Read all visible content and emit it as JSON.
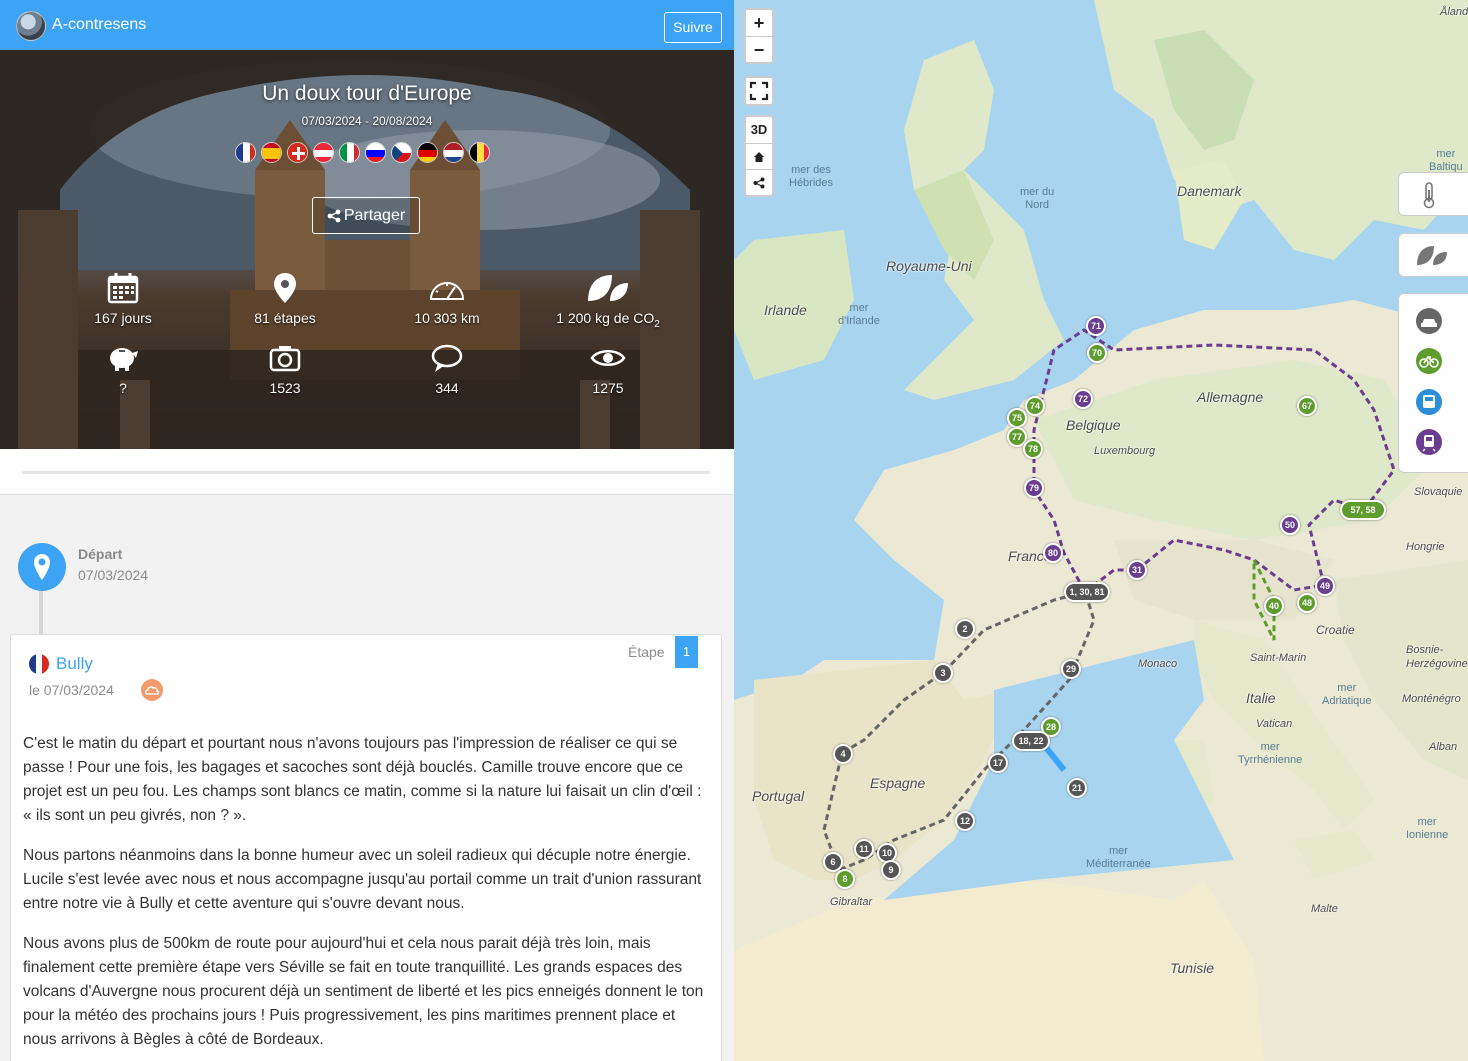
{
  "header": {
    "author": "A-contresens",
    "follow_label": "Suivre"
  },
  "trip": {
    "title": "Un doux tour d'Europe",
    "dates": "07/03/2024 - 20/08/2024",
    "share_label": "Partager",
    "country_flags": [
      "france",
      "spain",
      "switzerland",
      "austria",
      "italy",
      "slovenia",
      "czech-republic",
      "germany",
      "netherlands",
      "belgium"
    ],
    "stats": {
      "days": "167 jours",
      "steps": "81 étapes",
      "distance": "10 303 km",
      "co2": "1 200 kg de CO",
      "co2_sub": "2",
      "budget": "?",
      "photos": "1523",
      "comments": "344",
      "views": "1275"
    }
  },
  "timeline": {
    "start_label": "Départ",
    "start_date": "07/03/2024"
  },
  "step": {
    "place": "Bully",
    "date": "le 07/03/2024",
    "label": "Étape",
    "number": "1",
    "paragraphs": [
      "C'est le matin du départ et pourtant nous n'avons toujours pas l'impression de réaliser ce qui se passe ! Pour une fois, les bagages et sacoches sont déjà bouclés. Camille trouve encore que ce projet est un peu fou. Les champs sont blancs ce matin, comme si la nature lui faisait un clin d'œil : « ils sont un peu givrés, non ? ».",
      "Nous partons néanmoins dans la bonne humeur avec un soleil radieux qui décuple notre énergie. Lucile s'est levée avec nous et nous accompagne jusqu'au portail comme un trait d'union rassurant entre notre vie à Bully et cette aventure qui s'ouvre devant nous.",
      "Nous avons plus de 500km de route pour aujourd'hui et cela nous parait déjà très loin, mais finalement cette première étape vers Séville se fait en toute tranquillité. Les grands espaces des volcans d'Auvergne nous procurent déjà un sentiment de liberté et les pics enneigés donnent le ton pour la météo des prochains jours ! Puis progressivement, les pins maritimes prennent place et nous arrivons à Bègles à côté de Bordeaux."
    ]
  },
  "map": {
    "controls": {
      "zoom_in": "+",
      "zoom_out": "−",
      "three_d": "3D"
    },
    "labels": {
      "danemark": "Danemark",
      "royaume_uni": "Royaume-Uni",
      "irlande": "Irlande",
      "belgique": "Belgique",
      "luxembourg": "Luxembourg",
      "allemagne": "Allemagne",
      "france": "France",
      "espagne": "Espagne",
      "portugal": "Portugal",
      "italie": "Italie",
      "monaco": "Monaco",
      "saint_marin": "Saint-Marin",
      "vatican": "Vatican",
      "croatie": "Croatie",
      "bosnie": "Bosnie-\nHerzégovine",
      "hongrie": "Hongrie",
      "slovaquie": "Slovaquie",
      "montenegro": "Monténégro",
      "albanie": "Alban",
      "tunisie": "Tunisie",
      "malte": "Malte",
      "gibraltar": "Gibraltar",
      "aland": "Åland"
    },
    "seas": {
      "hebrides": "mer des\nHébrides",
      "nord": "mer du\nNord",
      "irlande": "mer\nd'Irlande",
      "baltique": "mer\nBaltiqu",
      "adriatique": "mer\nAdriatique",
      "tyrrhenienne": "mer\nTyrrhénienne",
      "mediterranee": "mer\nMéditerranée",
      "ionienne": "mer\nIonienne"
    },
    "markers": {
      "m71": "71",
      "m70": "70",
      "m74": "74",
      "m72": "72",
      "m75": "75",
      "m77": "77",
      "m78": "78",
      "m79": "79",
      "m80": "80",
      "m67": "67",
      "m50": "50",
      "m5758": "57, 58",
      "m31": "31",
      "m13081": "1, 30, 81",
      "m49": "49",
      "m48": "48",
      "m40": "40",
      "m2": "2",
      "m3": "3",
      "m29": "29",
      "m28": "28",
      "m1822": "18, 22",
      "m4": "4",
      "m17": "17",
      "m12": "12",
      "m21": "21",
      "m11": "11",
      "m10": "10",
      "m6": "6",
      "m8": "8",
      "m9": "9"
    },
    "transport_modes": [
      "car-icon",
      "bike-icon",
      "bus-icon",
      "train-icon"
    ],
    "colors": {
      "purple": "#6a3d8f",
      "green": "#5e9c2d",
      "grey": "#555555",
      "accent": "#3da3f5"
    }
  }
}
